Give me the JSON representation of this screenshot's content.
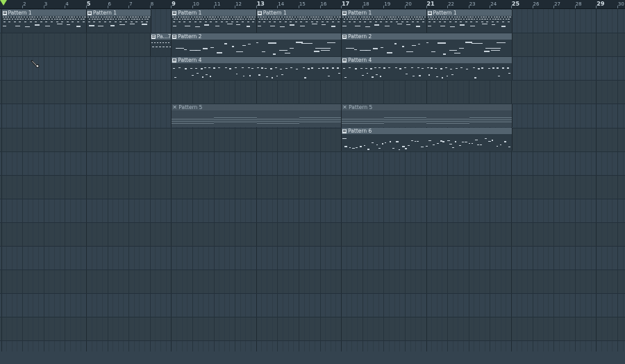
{
  "ruler": {
    "bars": [
      "2",
      "3",
      "4",
      "5",
      "6",
      "7",
      "8",
      "9",
      "10",
      "11",
      "12",
      "13",
      "14",
      "15",
      "16",
      "17",
      "18",
      "19",
      "20",
      "21",
      "22",
      "23",
      "24",
      "25",
      "26",
      "27",
      "28",
      "29",
      "30"
    ],
    "major_bars": [
      "5",
      "9",
      "13",
      "17",
      "21",
      "25",
      "29"
    ]
  },
  "colors": {
    "background": "#34434f",
    "clip_body": "#2d3b45",
    "clip_header": "#53636f",
    "note": "#dce6ec",
    "playhead": "#9be05a"
  },
  "clips": [
    {
      "id": "p1a",
      "track": 0,
      "start": 1,
      "end": 5,
      "label": "Pattern 1",
      "style": "p1"
    },
    {
      "id": "p1b",
      "track": 0,
      "start": 5,
      "end": 8,
      "label": "Pattern 1",
      "style": "p1"
    },
    {
      "id": "p1c",
      "track": 0,
      "start": 9,
      "end": 13,
      "label": "Pattern 1",
      "style": "p1"
    },
    {
      "id": "p1d",
      "track": 0,
      "start": 13,
      "end": 17,
      "label": "Pattern 1",
      "style": "p1"
    },
    {
      "id": "p1e",
      "track": 0,
      "start": 17,
      "end": 21,
      "label": "Pattern 1",
      "style": "p1"
    },
    {
      "id": "p1f",
      "track": 0,
      "start": 21,
      "end": 25,
      "label": "Pattern 1",
      "style": "p1"
    },
    {
      "id": "p7",
      "track": 1,
      "start": 8,
      "end": 9,
      "label": "Pa...7",
      "style": "p7"
    },
    {
      "id": "p2a",
      "track": 1,
      "start": 9,
      "end": 17,
      "label": "Pattern 2",
      "style": "p2"
    },
    {
      "id": "p2b",
      "track": 1,
      "start": 17,
      "end": 25,
      "label": "Pattern 2",
      "style": "p2"
    },
    {
      "id": "p4a",
      "track": 2,
      "start": 9,
      "end": 17,
      "label": "Pattern 4",
      "style": "p4"
    },
    {
      "id": "p4b",
      "track": 2,
      "start": 17,
      "end": 25,
      "label": "Pattern 4",
      "style": "p4"
    },
    {
      "id": "p5a",
      "track": 4,
      "start": 9,
      "end": 17,
      "label": "Pattern 5",
      "style": "p5",
      "muted": true
    },
    {
      "id": "p5b",
      "track": 4,
      "start": 17,
      "end": 25,
      "label": "Pattern 5",
      "style": "p5",
      "muted": true
    },
    {
      "id": "p6",
      "track": 5,
      "start": 17,
      "end": 25,
      "label": "Pattern 6",
      "style": "p6"
    }
  ]
}
